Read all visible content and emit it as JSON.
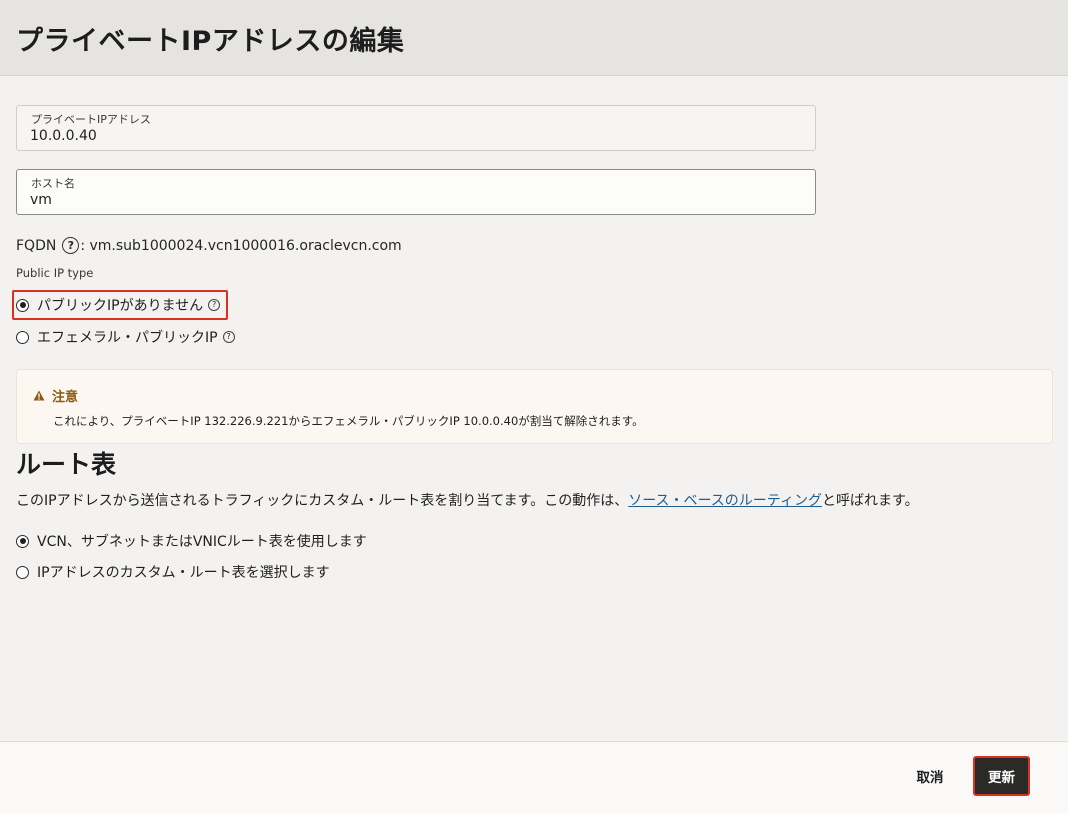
{
  "header": {
    "title": "プライベートIPアドレスの編集"
  },
  "fields": {
    "private_ip": {
      "label": "プライベートIPアドレス",
      "value": "10.0.0.40"
    },
    "hostname": {
      "label": "ホスト名",
      "value": "vm"
    }
  },
  "fqdn": {
    "label": "FQDN",
    "help_icon": "question-circle-icon",
    "value": ": vm.sub1000024.vcn1000016.oraclevcn.com"
  },
  "public_ip_type": {
    "label": "Public IP type",
    "options": [
      {
        "label": "パブリックIPがありません",
        "selected": true,
        "help_icon": "question-circle-icon"
      },
      {
        "label": "エフェメラル・パブリックIP",
        "selected": false,
        "help_icon": "question-circle-icon"
      }
    ]
  },
  "notice": {
    "icon": "warning-triangle-icon",
    "title": "注意",
    "text": "これにより、プライベートIP 132.226.9.221からエフェメラル・パブリックIP 10.0.0.40が割当て解除されます。"
  },
  "route_table": {
    "title": "ルート表",
    "description_before": "このIPアドレスから送信されるトラフィックにカスタム・ルート表を割り当てます。この動作は、",
    "description_link": "ソース・ベースのルーティング",
    "description_after": "と呼ばれます。",
    "options": [
      {
        "label": "VCN、サブネットまたはVNICルート表を使用します",
        "selected": true
      },
      {
        "label": "IPアドレスのカスタム・ルート表を選択します",
        "selected": false
      }
    ]
  },
  "footer": {
    "cancel_label": "取消",
    "update_label": "更新"
  },
  "colors": {
    "focus_outline": "#d9321f",
    "primary_button": "#2b2a28",
    "link": "#1f5d8e",
    "warning": "#8a5a12"
  }
}
